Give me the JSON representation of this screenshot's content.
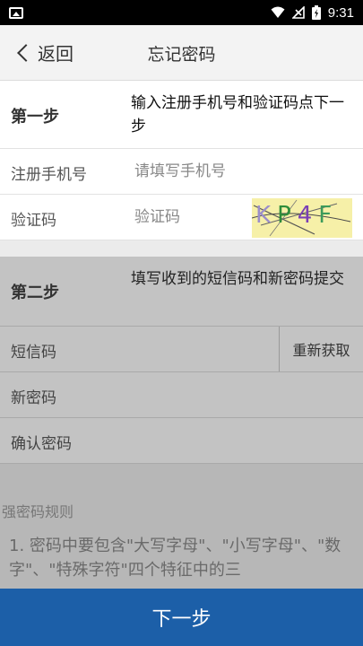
{
  "status_bar": {
    "time": "9:31"
  },
  "header": {
    "back_label": "返回",
    "title": "忘记密码"
  },
  "step1": {
    "label": "第一步",
    "description": "输入注册手机号和验证码点下一步",
    "phone": {
      "label": "注册手机号",
      "placeholder": "请填写手机号"
    },
    "captcha": {
      "label": "验证码",
      "placeholder": "验证码",
      "chars": [
        "K",
        "P",
        "4",
        "F"
      ]
    }
  },
  "step2": {
    "label": "第二步",
    "description": "填写收到的短信码和新密码提交",
    "sms": {
      "label": "短信码",
      "resend_label": "重新获取"
    },
    "new_password": {
      "label": "新密码"
    },
    "confirm_password": {
      "label": "确认密码"
    }
  },
  "rules": {
    "title": "强密码规则",
    "items": [
      "1. 密码中要包含\"大写字母\"、\"小写字母\"、\"数字\"、\"特殊字符\"四个特征中的三"
    ]
  },
  "footer": {
    "next_label": "下一步"
  },
  "colors": {
    "primary": "#1c5fa8",
    "captcha_bg": "#f6f0a8"
  }
}
